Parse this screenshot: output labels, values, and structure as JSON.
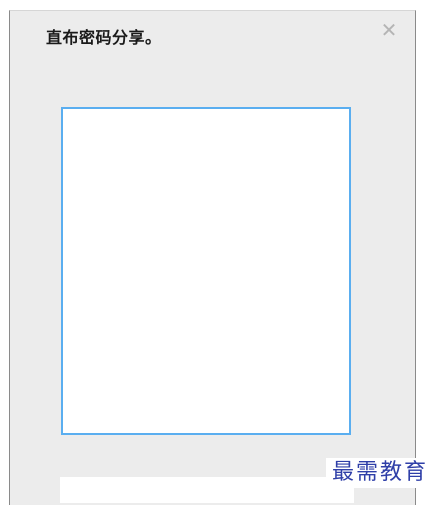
{
  "dialog": {
    "title": "直布密码分享。",
    "close_glyph": "✕"
  },
  "watermark": {
    "text": "最需教育"
  },
  "colors": {
    "dialog_bg": "#ececec",
    "qr_border": "#5aaef0",
    "watermark": "#2f3fa8"
  }
}
